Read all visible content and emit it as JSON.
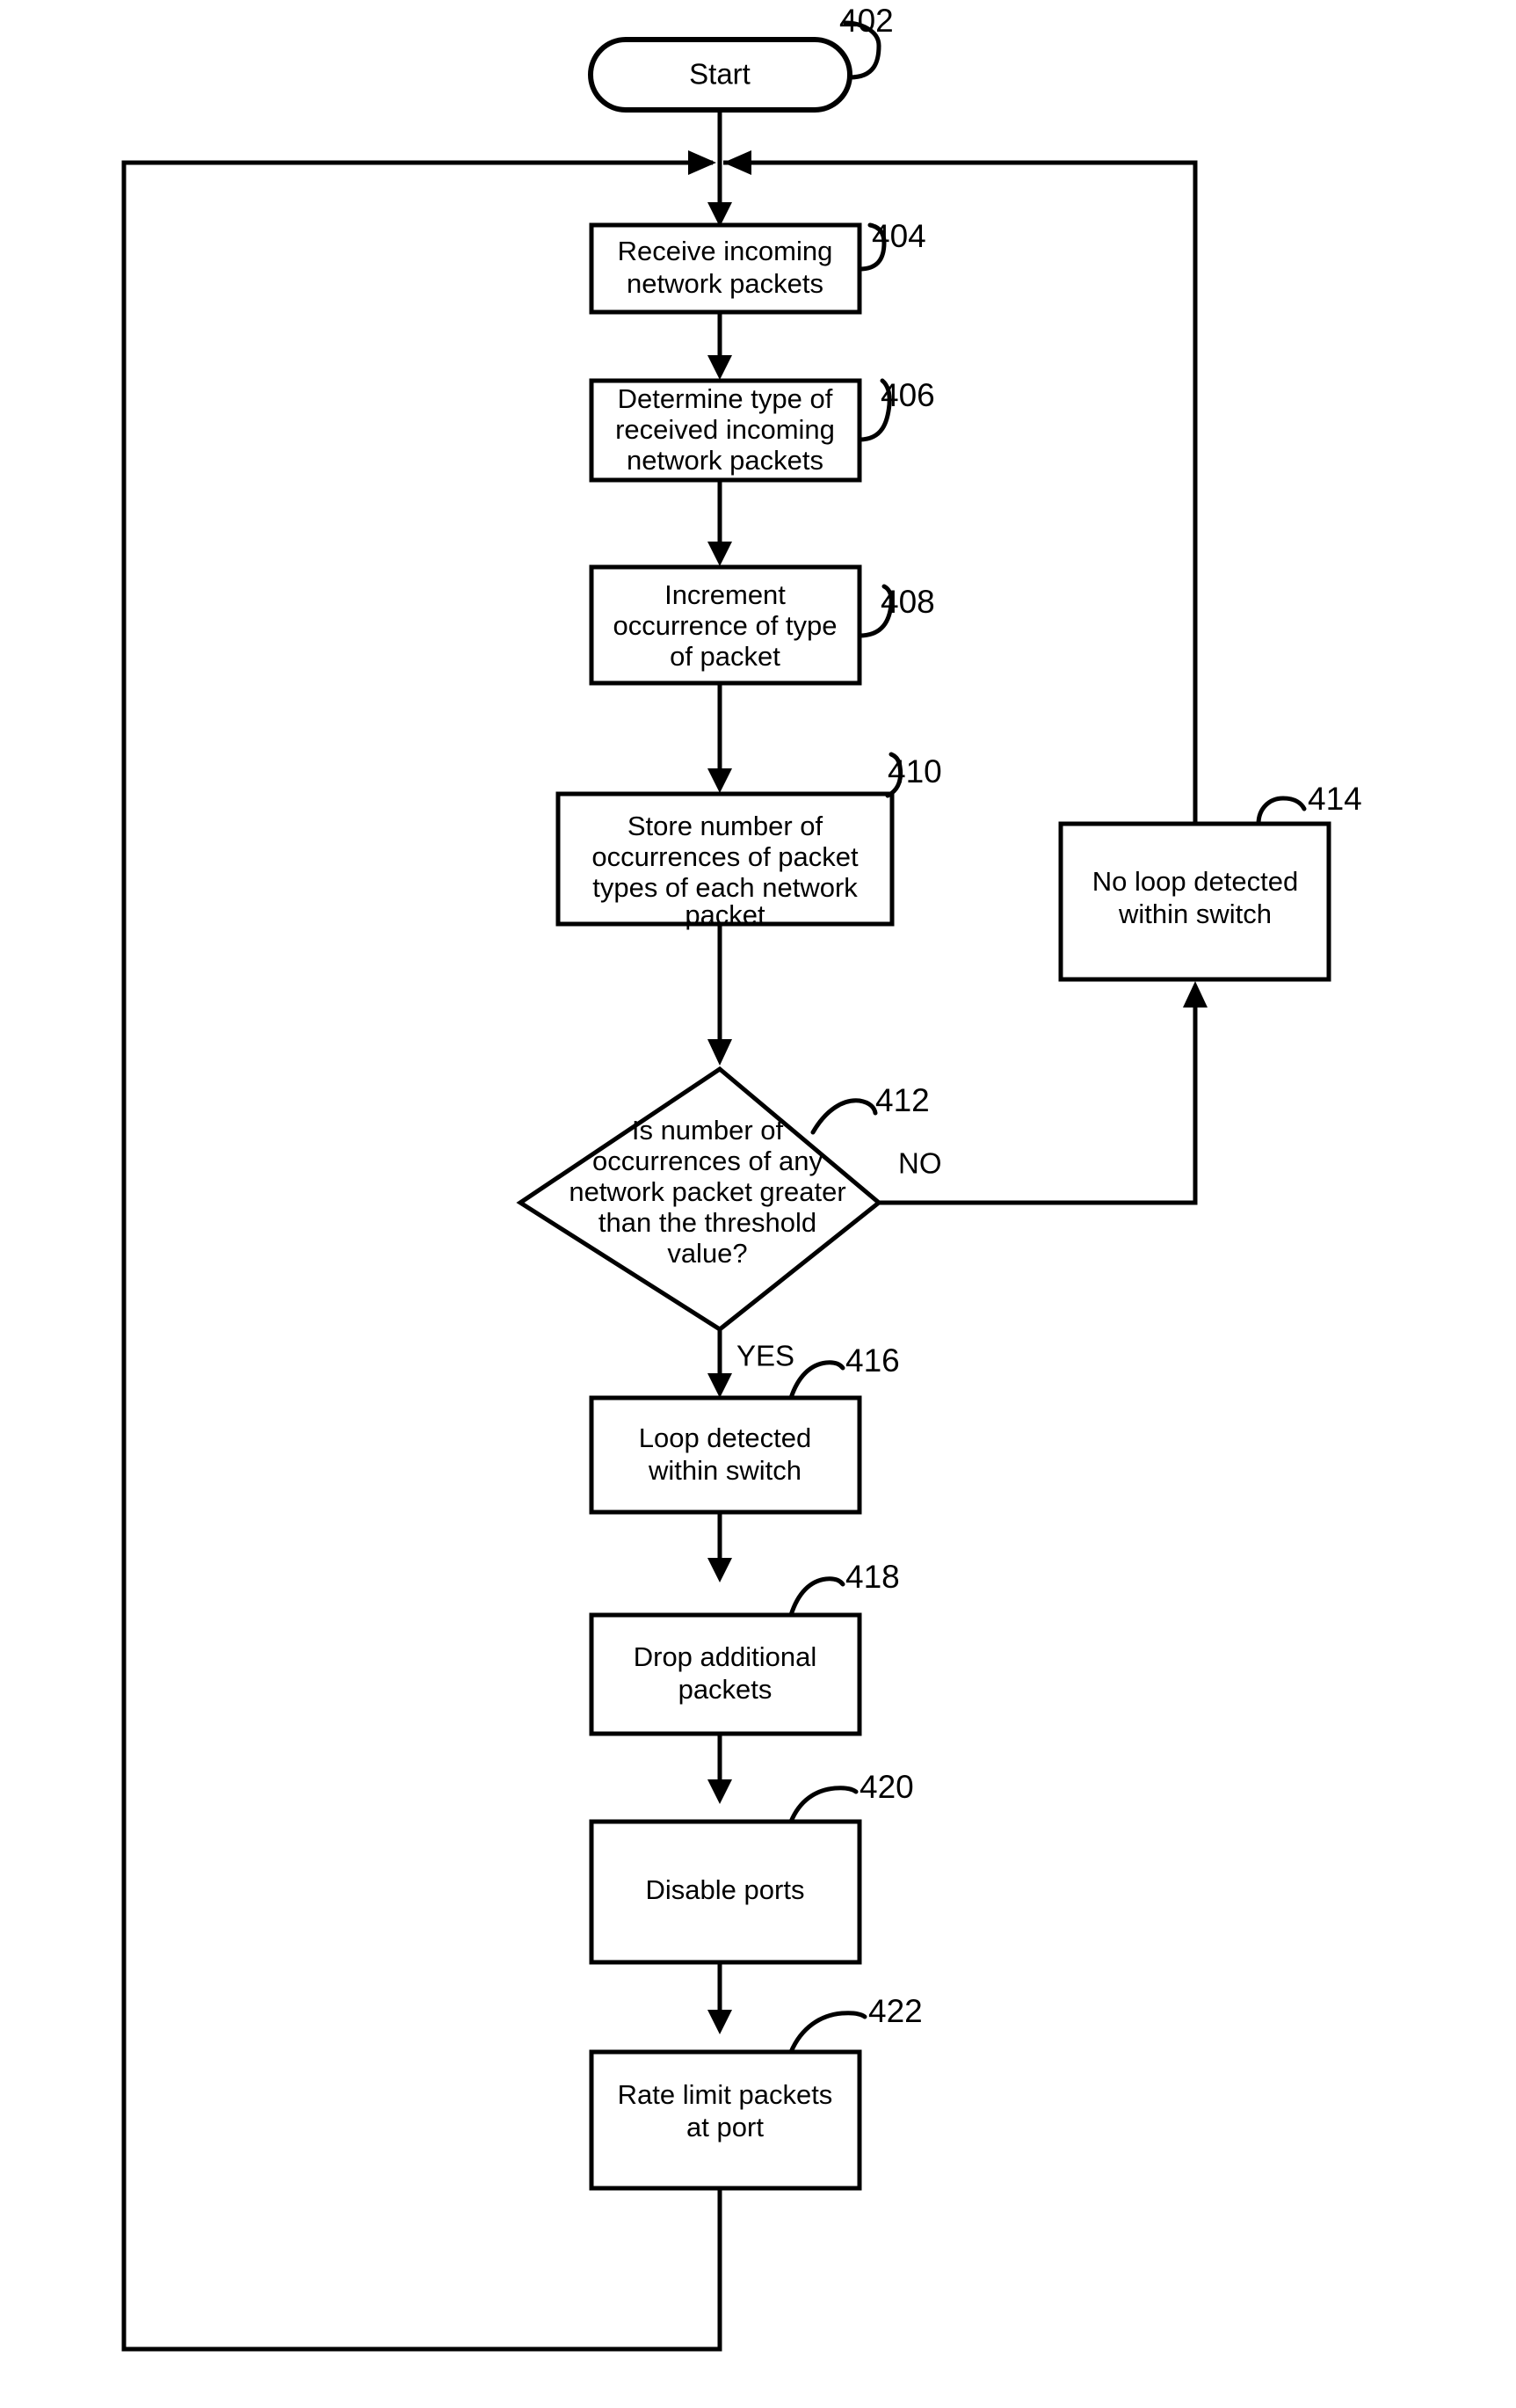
{
  "figure": {
    "type": "flowchart",
    "orientation": "vertical",
    "background_color": "#ffffff",
    "line_color": "#000000"
  },
  "nodes": {
    "start": {
      "ref": "402",
      "shape": "terminal",
      "lines": [
        "Start"
      ]
    },
    "receive": {
      "ref": "404",
      "shape": "process",
      "lines": [
        "Receive incoming",
        "network packets"
      ]
    },
    "determine": {
      "ref": "406",
      "shape": "process",
      "lines": [
        "Determine type of",
        "received incoming",
        "network packets"
      ]
    },
    "increment": {
      "ref": "408",
      "shape": "process",
      "lines": [
        "Increment",
        "occurrence of type",
        "of packet"
      ]
    },
    "store": {
      "ref": "410",
      "shape": "process",
      "lines": [
        "Store number of",
        "occurrences of packet",
        "types of each network",
        "packet"
      ]
    },
    "decision": {
      "ref": "412",
      "shape": "decision",
      "lines": [
        "Is number of",
        "occurrences of any",
        "network packet greater",
        "than the threshold",
        "value?"
      ]
    },
    "no_loop": {
      "ref": "414",
      "shape": "process",
      "lines": [
        "No loop detected",
        "within switch"
      ]
    },
    "loop_detected": {
      "ref": "416",
      "shape": "process",
      "lines": [
        "Loop detected",
        "within switch"
      ]
    },
    "drop": {
      "ref": "418",
      "shape": "process",
      "lines": [
        "Drop additional",
        "packets"
      ]
    },
    "disable": {
      "ref": "420",
      "shape": "process",
      "lines": [
        "Disable ports"
      ]
    },
    "rate_limit": {
      "ref": "422",
      "shape": "process",
      "lines": [
        "Rate limit packets",
        "at port"
      ]
    }
  },
  "branch_labels": {
    "no": "NO",
    "yes": "YES"
  }
}
